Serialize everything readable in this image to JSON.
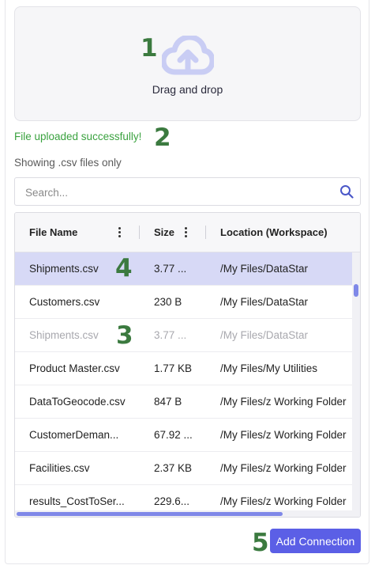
{
  "upload": {
    "dropzone_label": "Drag and drop",
    "icon": "cloud-upload-icon",
    "success_message": "File uploaded successfully!",
    "filter_note": "Showing .csv files only"
  },
  "search": {
    "placeholder": "Search...",
    "value": "",
    "icon": "search-icon"
  },
  "table": {
    "columns": [
      "File Name",
      "Size",
      "Location (Workspace)"
    ],
    "rows": [
      {
        "name": "Shipments.csv",
        "size": "3.77 ...",
        "location": "/My Files/DataStar",
        "state": "selected"
      },
      {
        "name": "Customers.csv",
        "size": "230 B",
        "location": "/My Files/DataStar",
        "state": "normal"
      },
      {
        "name": "Shipments.csv",
        "size": "3.77 ...",
        "location": "/My Files/DataStar",
        "state": "disabled"
      },
      {
        "name": "Product Master.csv",
        "size": "1.77 KB",
        "location": "/My Files/My Utilities",
        "state": "normal"
      },
      {
        "name": "DataToGeocode.csv",
        "size": "847 B",
        "location": "/My Files/z Working Folder",
        "state": "normal"
      },
      {
        "name": "CustomerDeman...",
        "size": "67.92 ...",
        "location": "/My Files/z Working Folder",
        "state": "normal"
      },
      {
        "name": "Facilities.csv",
        "size": "2.37 KB",
        "location": "/My Files/z Working Folder",
        "state": "normal"
      },
      {
        "name": "results_CostToSer...",
        "size": "229.6...",
        "location": "/My Files/z Working Folder",
        "state": "normal"
      }
    ]
  },
  "actions": {
    "add_connection_label": "Add Connection"
  },
  "markers": [
    "1",
    "2",
    "3",
    "4",
    "5"
  ],
  "colors": {
    "accent": "#5b5fe6",
    "success": "#3aa23f",
    "selected_row": "#d7d9f6",
    "marker": "#3b7a3f",
    "upload_icon": "#c9cdf4"
  }
}
